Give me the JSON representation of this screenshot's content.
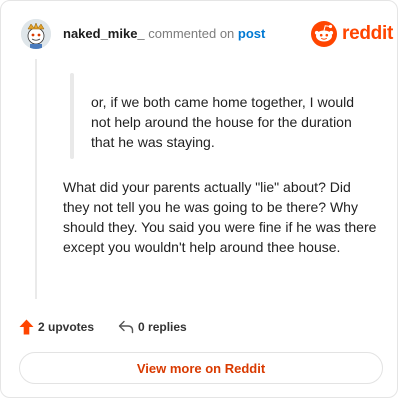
{
  "author": {
    "username": "naked_mike_",
    "action_text": "commented on",
    "target_link": "post",
    "avatar_icon": "snoo-avatar-icon"
  },
  "brand": {
    "name": "reddit",
    "logo_icon": "reddit-logo-icon",
    "color": "#ff4500"
  },
  "comment": {
    "quote": "or, if we both came home together, I would not help around the house for the duration that he was staying.",
    "body": "What did your parents actually \"lie\" about? Did they not tell you he was going to be there? Why should they. You said you were fine if he was there except you wouldn't help around thee house."
  },
  "actions": {
    "upvotes_label": "2 upvotes",
    "upvote_icon": "upvote-arrow-icon",
    "replies_label": "0 replies",
    "reply_icon": "reply-icon"
  },
  "cta": {
    "label": "View more on Reddit"
  }
}
